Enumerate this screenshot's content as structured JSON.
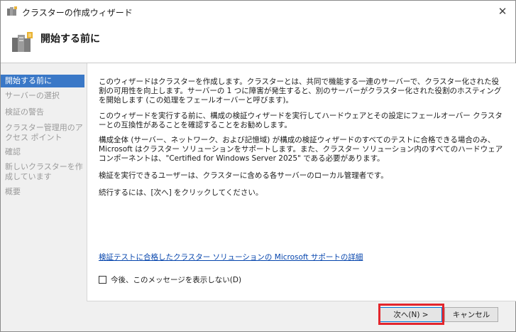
{
  "window": {
    "title": "クラスターの作成ウィザード",
    "close_glyph": "✕"
  },
  "header": {
    "title": "開始する前に"
  },
  "sidebar": {
    "items": [
      {
        "label": "開始する前に",
        "active": true
      },
      {
        "label": "サーバーの選択",
        "active": false
      },
      {
        "label": "検証の警告",
        "active": false
      },
      {
        "label": "クラスター管理用のアクセス ポイント",
        "active": false
      },
      {
        "label": "確認",
        "active": false
      },
      {
        "label": "新しいクラスターを作成しています",
        "active": false
      },
      {
        "label": "概要",
        "active": false
      }
    ]
  },
  "content": {
    "paragraphs": [
      "このウィザードはクラスターを作成します。クラスターとは、共同で機能する一連のサーバーで、クラスター化された役割の可用性を向上します。サーバーの 1 つに障害が発生すると、別のサーバーがクラスター化された役割のホスティングを開始します (この処理をフェールオーバーと呼びます)。",
      "このウィザードを実行する前に、構成の検証ウィザードを実行してハードウェアとその設定にフェールオーバー クラスターとの互換性があることを確認することをお勧めします。",
      "構成全体 (サーバー、ネットワーク、および記憶域) が構成の検証ウィザードのすべてのテストに合格できる場合のみ、Microsoft はクラスター ソリューションをサポートします。また、クラスター ソリューション内のすべてのハードウェア コンポーネントは、\"Certified for Windows Server 2025\" である必要があります。",
      "検証を実行できるユーザーは、クラスターに含める各サーバーのローカル管理者です。",
      "続行するには、[次へ] をクリックしてください。"
    ],
    "link": "検証テストに合格したクラスター ソリューションの Microsoft サポートの詳細",
    "checkbox_label": "今後、このメッセージを表示しない(D)",
    "checkbox_checked": false
  },
  "footer": {
    "next_label": "次へ(N) >",
    "cancel_label": "キャンセル"
  },
  "colors": {
    "accent": "#3a78c7",
    "highlight": "#e3262d",
    "link": "#0645ad"
  }
}
